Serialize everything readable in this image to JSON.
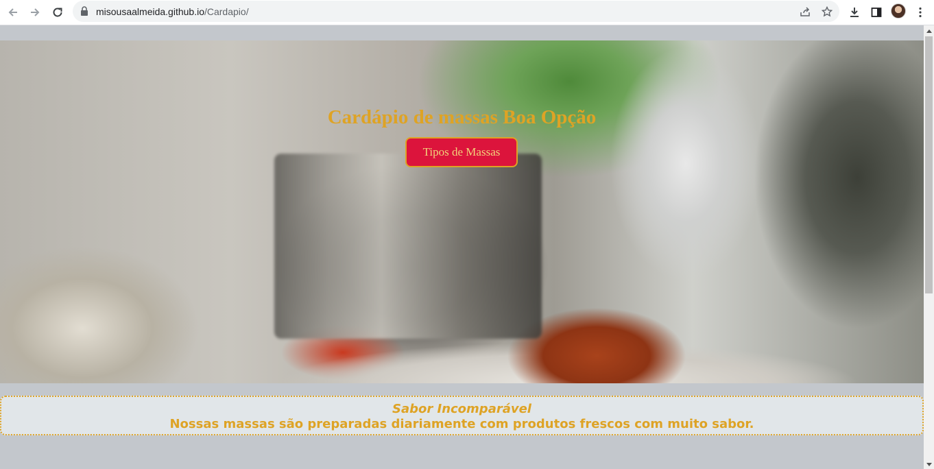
{
  "browser": {
    "url_host": "misousaalmeida.github.io",
    "url_path": "/Cardapio/",
    "icons": [
      "back-icon",
      "forward-icon",
      "reload-icon",
      "lock-icon",
      "share-icon",
      "bookmark-star-icon",
      "download-icon",
      "side-panel-icon",
      "profile-avatar",
      "menu-kebab-icon"
    ]
  },
  "hero": {
    "title": "Cardápio de massas Boa Opção",
    "button_label": "Tipos de Massas"
  },
  "tagline": {
    "heading": "Sabor Incomparável",
    "text": "Nossas massas são preparadas diariamente com produtos frescos com muito sabor."
  },
  "colors": {
    "accent_gold": "#dea325",
    "button_red": "#dc143c",
    "page_bg": "#c3c7cc"
  }
}
